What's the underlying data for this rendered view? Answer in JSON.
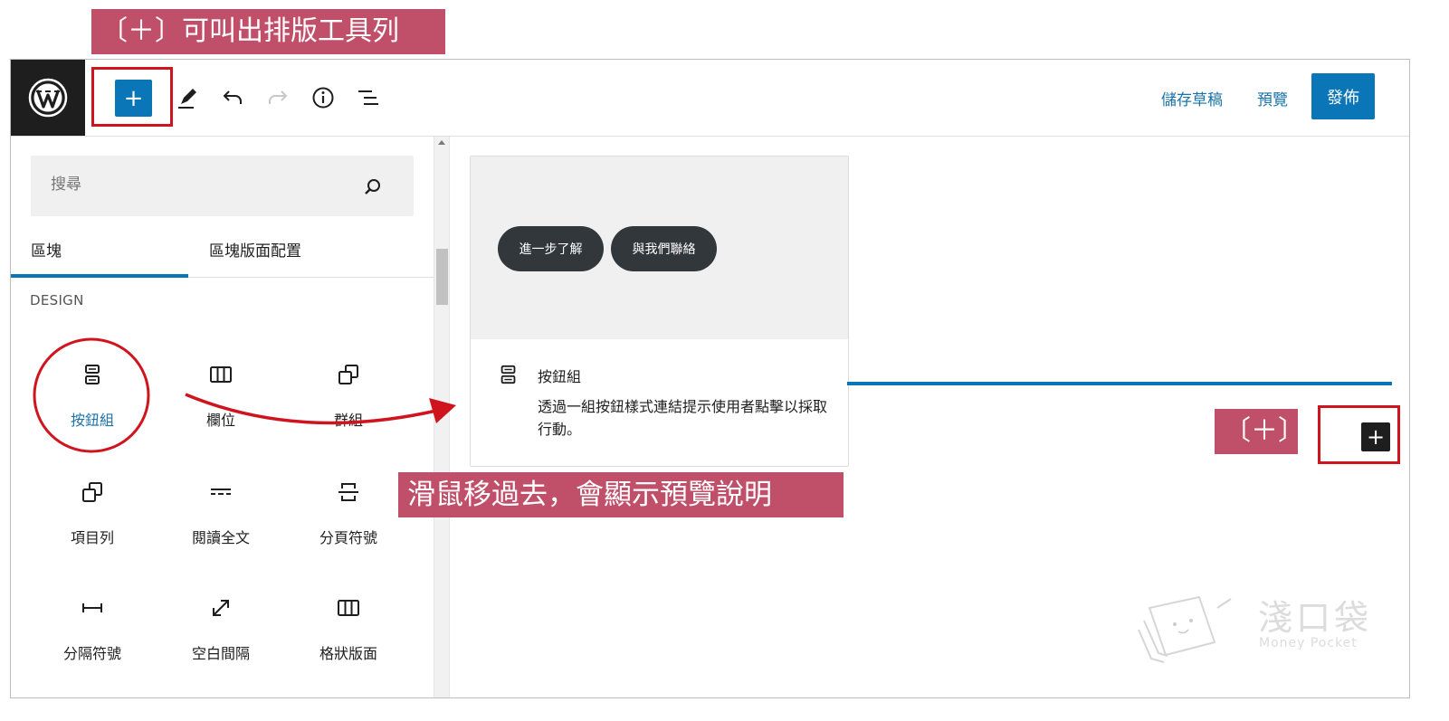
{
  "annotations": {
    "top": "〔＋〕可叫出排版工具列",
    "middle": "滑鼠移過去，會顯示預覽說明",
    "plus": "〔＋〕"
  },
  "toolbar": {
    "inserter": "+",
    "save_draft": "儲存草稿",
    "preview": "預覽",
    "publish": "發佈"
  },
  "sidebar": {
    "search_placeholder": "搜尋",
    "tabs": [
      "區塊",
      "區塊版面配置"
    ],
    "category": "DESIGN",
    "blocks": [
      {
        "label": "按鈕組",
        "icon": "buttons-icon"
      },
      {
        "label": "欄位",
        "icon": "columns-icon"
      },
      {
        "label": "群組",
        "icon": "group-icon"
      },
      {
        "label": "項目列",
        "icon": "row-icon"
      },
      {
        "label": "閱讀全文",
        "icon": "more-icon"
      },
      {
        "label": "分頁符號",
        "icon": "page-break-icon"
      },
      {
        "label": "分隔符號",
        "icon": "separator-icon"
      },
      {
        "label": "空白間隔",
        "icon": "spacer-icon"
      },
      {
        "label": "格狀版面",
        "icon": "grid-icon"
      }
    ]
  },
  "preview": {
    "buttons": [
      "進一步了解",
      "與我們聯絡"
    ],
    "title": "按鈕組",
    "description": "透過一組按鈕樣式連結提示使用者點擊以採取行動。"
  },
  "canvas": {
    "add_block": "+"
  },
  "watermark": {
    "title": "淺口袋",
    "subtitle": "Money Pocket"
  },
  "colors": {
    "accent": "#0a76b8",
    "annotation": "#c0506a",
    "highlight": "#d0141e"
  }
}
